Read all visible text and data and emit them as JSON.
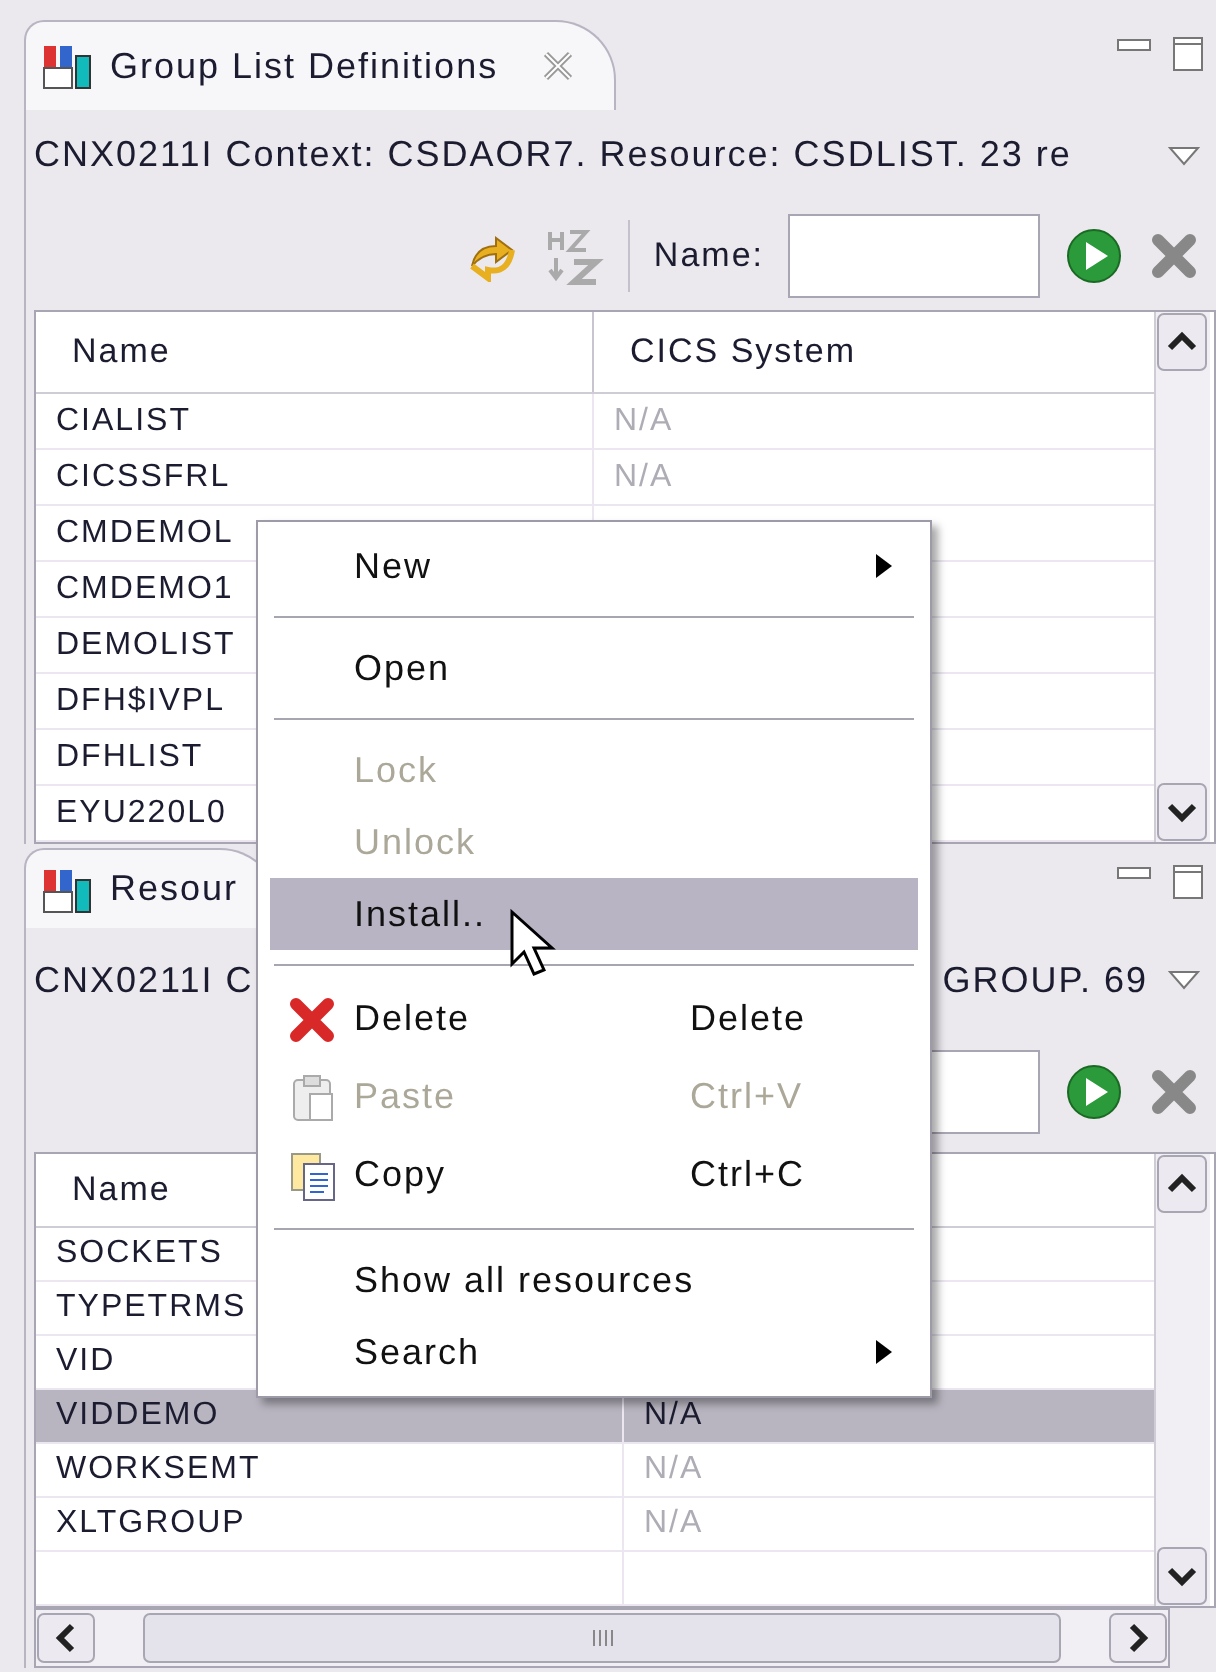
{
  "views": [
    {
      "tab": {
        "title": "Group List Definitions",
        "closable": true
      },
      "context": [
        "CNX0211I Context: CSDAOR7. Resource: CSDLIST. 23 re"
      ],
      "toolbar": {
        "name_label": "Name:"
      },
      "columns": [
        "Name",
        "CICS System"
      ],
      "rows": [
        {
          "cells": [
            "CIALIST",
            "N/A"
          ],
          "selected": false
        },
        {
          "cells": [
            "CICSSFRL",
            "N/A"
          ],
          "selected": false
        },
        {
          "cells": [
            "CMDEMOL"
          ],
          "selected": false
        },
        {
          "cells": [
            "CMDEMO1"
          ],
          "selected": false
        },
        {
          "cells": [
            "DEMOLIST"
          ],
          "selected": false
        },
        {
          "cells": [
            "DFH$IVPL"
          ],
          "selected": false
        },
        {
          "cells": [
            "DFHLIST"
          ],
          "selected": false
        },
        {
          "cells": [
            "EYU220L0"
          ],
          "selected": false
        }
      ],
      "hscroll": false
    },
    {
      "tab": {
        "title": "Resour",
        "closable": false
      },
      "context": [
        "CNX0211I C",
        "GROUP. 69"
      ],
      "columns": [
        "Name"
      ],
      "rows": [
        {
          "cells": [
            "SOCKETS"
          ],
          "selected": false
        },
        {
          "cells": [
            "TYPETRMS"
          ],
          "selected": false
        },
        {
          "cells": [
            "VID"
          ],
          "selected": false
        },
        {
          "cells": [
            "VIDDEMO",
            "N/A"
          ],
          "selected": true
        },
        {
          "cells": [
            "WORKSEMT",
            "N/A"
          ],
          "selected": false
        },
        {
          "cells": [
            "XLTGROUP",
            "N/A"
          ],
          "selected": false
        },
        {
          "cells": [],
          "selected": false
        }
      ],
      "hscroll": true
    }
  ],
  "context_menu": [
    {
      "kind": "item",
      "label": "New",
      "submenu": true,
      "disabled": false,
      "selected": false
    },
    {
      "kind": "separator"
    },
    {
      "kind": "item",
      "label": "Open",
      "disabled": false,
      "selected": false
    },
    {
      "kind": "separator"
    },
    {
      "kind": "item",
      "label": "Lock",
      "disabled": true,
      "selected": false
    },
    {
      "kind": "item",
      "label": "Unlock",
      "disabled": true,
      "selected": false
    },
    {
      "kind": "item",
      "label": "Install..",
      "disabled": false,
      "selected": true
    },
    {
      "kind": "separator"
    },
    {
      "kind": "icon_item",
      "label": "Delete",
      "shortcut": "Delete",
      "disabled": false,
      "selected": false
    },
    {
      "kind": "icon_item",
      "label": "Paste",
      "shortcut": "Ctrl+V",
      "disabled": true,
      "selected": false
    },
    {
      "kind": "icon_item",
      "label": "Copy",
      "shortcut": "Ctrl+C",
      "disabled": false,
      "selected": false
    },
    {
      "kind": "separator"
    },
    {
      "kind": "item",
      "label": "Show all resources",
      "disabled": false,
      "selected": false
    },
    {
      "kind": "item",
      "label": "Search",
      "submenu": true,
      "disabled": false,
      "selected": false
    }
  ]
}
